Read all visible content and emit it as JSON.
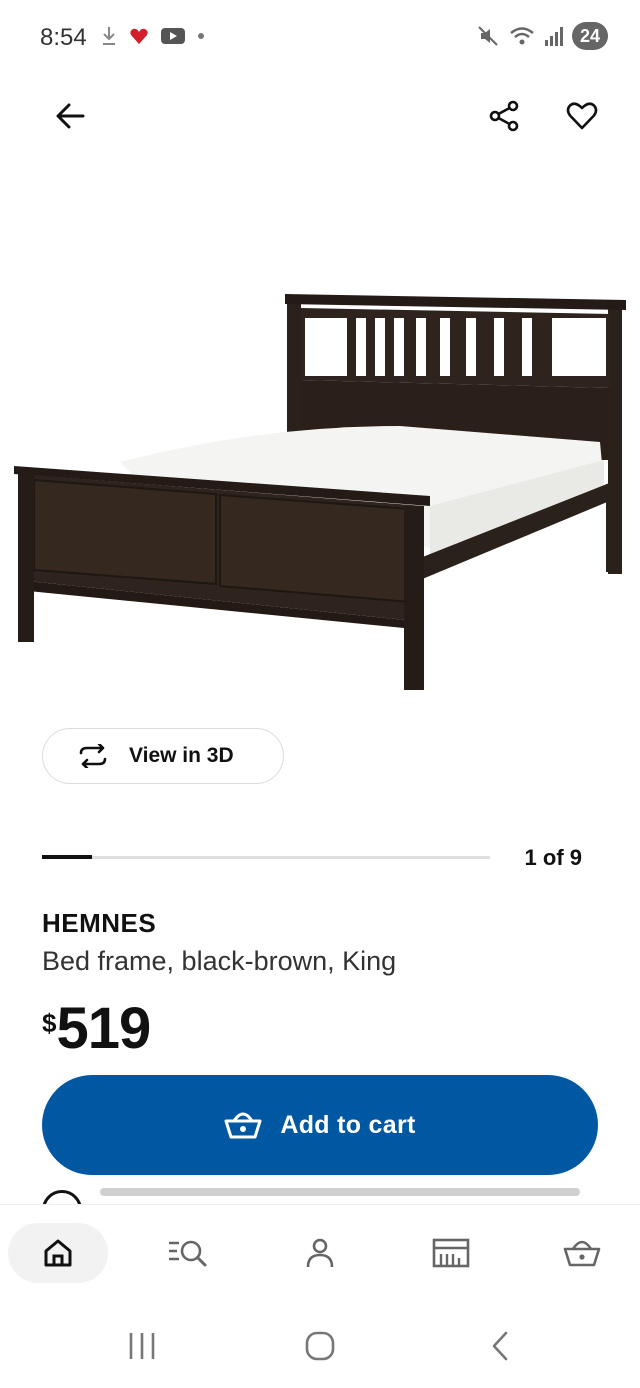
{
  "status_bar": {
    "time": "8:54",
    "left_icons": [
      "download-icon",
      "heart-app-icon",
      "youtube-icon",
      "dot-icon"
    ],
    "right_icons": [
      "mute-icon",
      "wifi-icon",
      "signal-icon"
    ],
    "battery": "24"
  },
  "top_bar": {
    "back_icon": "arrow-left-icon",
    "share_icon": "share-icon",
    "favorite_icon": "heart-outline-icon"
  },
  "product_image": {
    "alt": "HEMNES bed frame"
  },
  "view_3d": {
    "label": "View in 3D",
    "icon": "rotate-3d-icon"
  },
  "pager": {
    "text": "1 of 9",
    "current": 1,
    "total": 9
  },
  "product": {
    "name": "HEMNES",
    "description": "Bed frame, black-brown, King",
    "price_currency": "$",
    "price": "519"
  },
  "add_to_cart": {
    "label": "Add to cart",
    "icon": "basket-icon"
  },
  "bottom_nav": {
    "items": [
      {
        "icon": "home-icon",
        "active": true
      },
      {
        "icon": "search-list-icon",
        "active": false
      },
      {
        "icon": "profile-icon",
        "active": false
      },
      {
        "icon": "store-icon",
        "active": false
      },
      {
        "icon": "cart-icon",
        "active": false
      }
    ]
  },
  "system_nav": {
    "items": [
      "recents-icon",
      "home-circle-icon",
      "back-chevron-icon"
    ]
  },
  "colors": {
    "primary_blue": "#0058a3",
    "text": "#111111",
    "bed_wood": "#2b211b",
    "mattress": "#f4f4f2"
  }
}
